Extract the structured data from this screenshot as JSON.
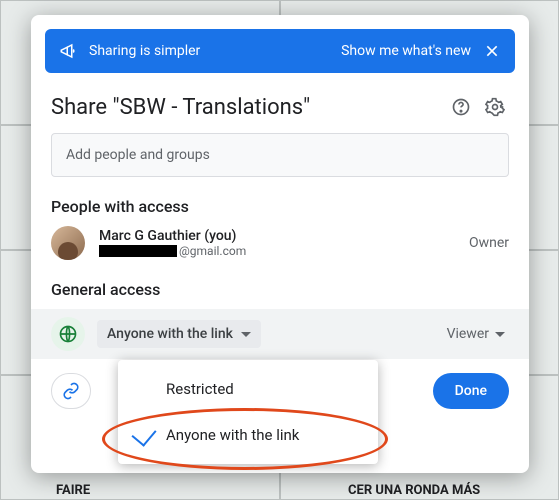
{
  "banner": {
    "message": "Sharing is simpler",
    "cta": "Show me what's new"
  },
  "title": "Share \"SBW - Translations\"",
  "input": {
    "placeholder": "Add people and groups"
  },
  "sections": {
    "people_title": "People with access",
    "general_title": "General access"
  },
  "people": [
    {
      "name": "Marc G Gauthier (you)",
      "email_suffix": "@gmail.com",
      "role": "Owner"
    }
  ],
  "general": {
    "current": "Anyone with the link",
    "permission": "Viewer",
    "options": [
      "Restricted",
      "Anyone with the link"
    ],
    "selected_index": 1
  },
  "footer": {
    "done": "Done"
  },
  "background": {
    "bottom_left": "FAIRE",
    "bottom_right": "CER UNA RONDA MÁS"
  }
}
